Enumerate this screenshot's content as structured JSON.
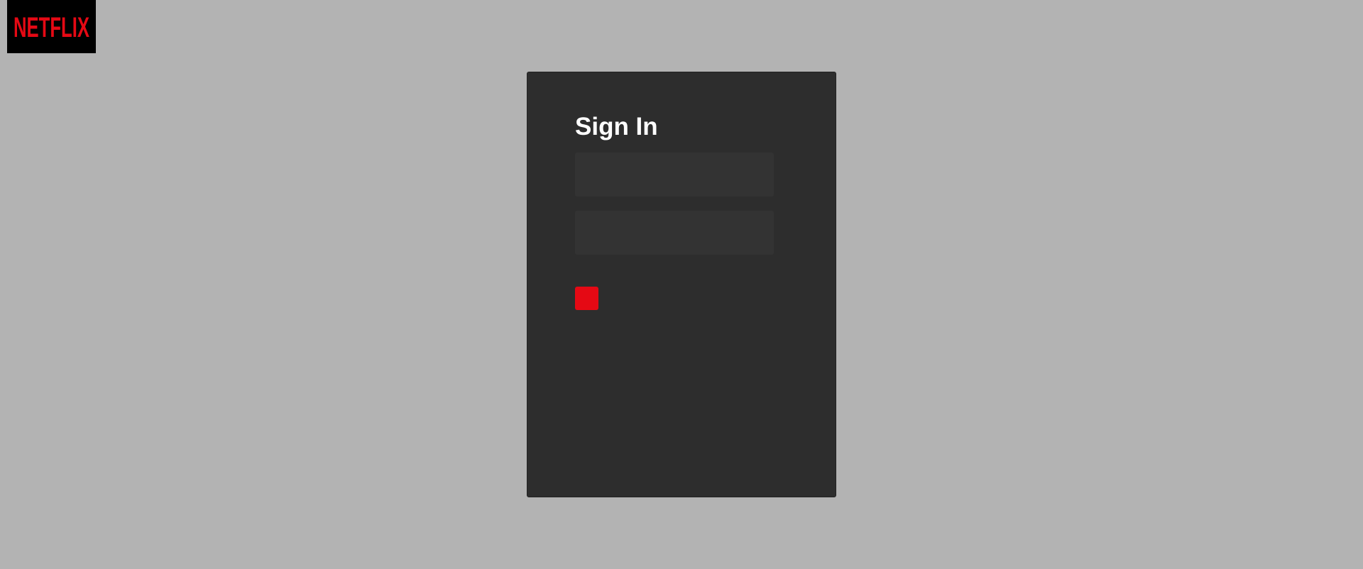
{
  "brand": {
    "logo_text": "NETFLIX",
    "logo_color": "#e50914",
    "logo_background": "#000000"
  },
  "page": {
    "background": "#b3b3b3"
  },
  "signin": {
    "title": "Sign In",
    "card_background": "#2d2d2d",
    "email_field": {
      "value": "",
      "placeholder": ""
    },
    "password_field": {
      "value": "",
      "placeholder": ""
    },
    "submit_button": {
      "label": "",
      "color": "#e50914"
    }
  }
}
